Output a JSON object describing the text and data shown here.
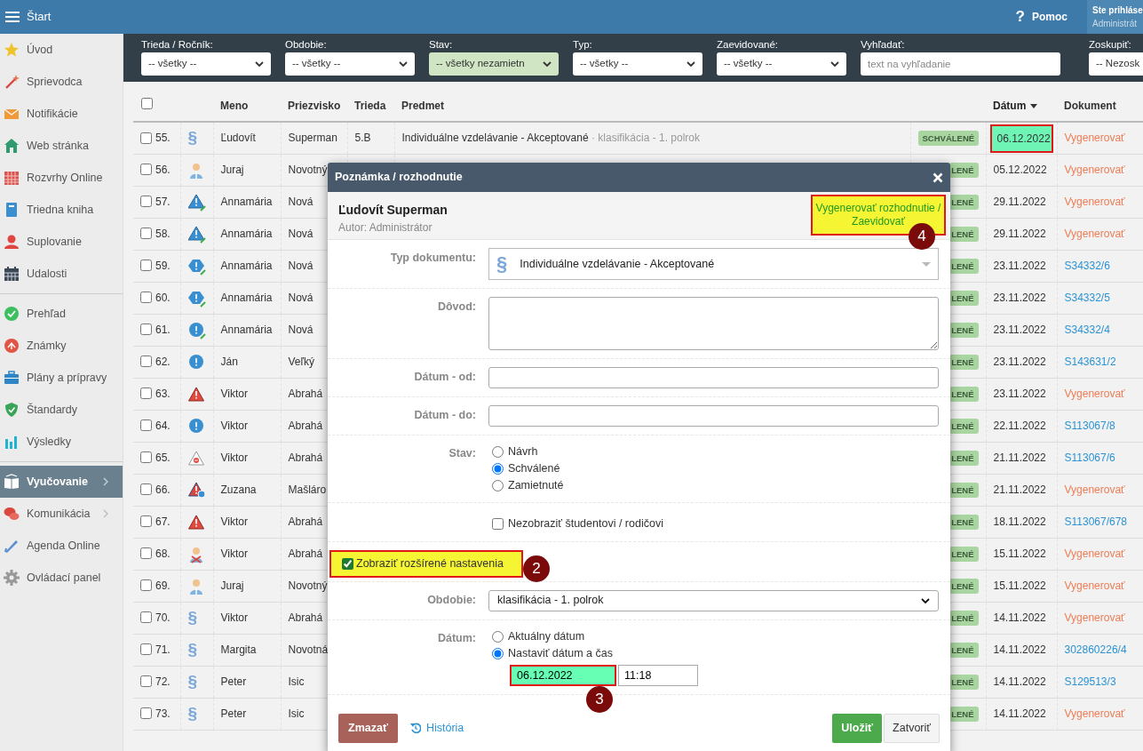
{
  "header": {
    "title": "Štart",
    "help_icon": "?",
    "help_label": "Pomoc",
    "user_line1": "Ste prihláse",
    "user_line2": "Administrát"
  },
  "sidebar": {
    "groups": [
      [
        {
          "label": "Úvod",
          "selected": false,
          "has_submenu": false
        },
        {
          "label": "Sprievodca",
          "selected": false,
          "has_submenu": false
        },
        {
          "label": "Notifikácie",
          "selected": false,
          "has_submenu": false
        },
        {
          "label": "Web stránka",
          "selected": false,
          "has_submenu": false
        },
        {
          "label": "Rozvrhy Online",
          "selected": false,
          "has_submenu": false
        },
        {
          "label": "Triedna kniha",
          "selected": false,
          "has_submenu": false
        },
        {
          "label": "Suplovanie",
          "selected": false,
          "has_submenu": false
        },
        {
          "label": "Udalosti",
          "selected": false,
          "has_submenu": false
        }
      ],
      [
        {
          "label": "Prehľad",
          "selected": false,
          "has_submenu": false
        },
        {
          "label": "Známky",
          "selected": false,
          "has_submenu": false
        },
        {
          "label": "Plány a prípravy",
          "selected": false,
          "has_submenu": false
        },
        {
          "label": "Štandardy",
          "selected": false,
          "has_submenu": false
        },
        {
          "label": "Výsledky",
          "selected": false,
          "has_submenu": false
        }
      ],
      [
        {
          "label": "Vyučovanie",
          "selected": true,
          "has_submenu": true
        },
        {
          "label": "Komunikácia",
          "selected": false,
          "has_submenu": true
        },
        {
          "label": "Agenda Online",
          "selected": false,
          "has_submenu": false
        },
        {
          "label": "Ovládací panel",
          "selected": false,
          "has_submenu": false
        }
      ]
    ]
  },
  "filters": [
    {
      "label": "Trieda / Ročník:",
      "kind": "select",
      "value": "-- všetky --",
      "highlighted": false
    },
    {
      "label": "Obdobie:",
      "kind": "select",
      "value": "-- všetky --",
      "highlighted": false
    },
    {
      "label": "Stav:",
      "kind": "select",
      "value": "-- všetky nezamietn",
      "highlighted": true
    },
    {
      "label": "Typ:",
      "kind": "select",
      "value": "-- všetky --",
      "highlighted": false
    },
    {
      "label": "Zaevidované:",
      "kind": "select",
      "value": "-- všetky --",
      "highlighted": false
    },
    {
      "label": "Vyhľadať:",
      "kind": "search",
      "placeholder": "text na vyhľadanie"
    },
    {
      "label": "Zoskupiť:",
      "kind": "select",
      "value": "-- Nezosk",
      "highlighted": false
    }
  ],
  "table": {
    "all_checked": false,
    "columns": [
      {
        "label": "Meno",
        "sorted": false
      },
      {
        "label": "Priezvisko",
        "sorted": false
      },
      {
        "label": "Trieda",
        "sorted": false
      },
      {
        "label": "Predmet",
        "sorted": false
      },
      {
        "label": "Dátum",
        "sorted": true
      },
      {
        "label": "Dokument",
        "sorted": false
      }
    ],
    "rows": [
      {
        "checked": false,
        "number": "55.",
        "kind": "paragraph",
        "symbol": "§",
        "name": "Ľudovít",
        "surname": "Superman",
        "class": "5.B",
        "subject": "Individuálne vzdelávanie - Akceptované",
        "subject_note": "· klasifikácia - 1. polrok",
        "status": "SCHVÁLENÉ",
        "date": "06.12.2022",
        "date_highlighted": true,
        "document": {
          "text": "Vygenerovať",
          "kind": "action"
        }
      },
      {
        "checked": false,
        "number": "56.",
        "kind": "person",
        "name": "Juraj",
        "surname": "Novotný",
        "status": "LENÉ",
        "date": "05.12.2022",
        "date_highlighted": false,
        "document": {
          "text": "Vygenerovať",
          "kind": "action"
        }
      },
      {
        "checked": false,
        "number": "57.",
        "kind": "draft",
        "name": "Annamária",
        "surname": "Nová",
        "status": "LENÉ",
        "date": "29.11.2022",
        "date_highlighted": false,
        "document": {
          "text": "Vygenerovať",
          "kind": "action"
        }
      },
      {
        "checked": false,
        "number": "58.",
        "kind": "draft",
        "name": "Annamária",
        "surname": "Nová",
        "status": "LENÉ",
        "date": "29.11.2022",
        "date_highlighted": false,
        "document": {
          "text": "Vygenerovať",
          "kind": "action"
        }
      },
      {
        "checked": false,
        "number": "59.",
        "kind": "pending",
        "name": "Annamária",
        "surname": "Nová",
        "status": "LENÉ",
        "date": "23.11.2022",
        "date_highlighted": false,
        "document": {
          "text": "S34332/6",
          "kind": "reference"
        }
      },
      {
        "checked": false,
        "number": "60.",
        "kind": "pending",
        "name": "Annamária",
        "surname": "Nová",
        "status": "LENÉ",
        "date": "23.11.2022",
        "date_highlighted": false,
        "document": {
          "text": "S34332/5",
          "kind": "reference"
        }
      },
      {
        "checked": false,
        "number": "61.",
        "kind": "noteedit",
        "name": "Annamária",
        "surname": "Nová",
        "status": "LENÉ",
        "date": "23.11.2022",
        "date_highlighted": false,
        "document": {
          "text": "S34332/4",
          "kind": "reference"
        }
      },
      {
        "checked": false,
        "number": "62.",
        "kind": "note",
        "name": "Ján",
        "surname": "Veľký",
        "status": "LENÉ",
        "date": "23.11.2022",
        "date_highlighted": false,
        "document": {
          "text": "S143631/2",
          "kind": "reference"
        }
      },
      {
        "checked": false,
        "number": "63.",
        "kind": "warning",
        "name": "Viktor",
        "surname": "Abrahá",
        "status": "LENÉ",
        "date": "23.11.2022",
        "date_highlighted": false,
        "document": {
          "text": "Vygenerovať",
          "kind": "action"
        }
      },
      {
        "checked": false,
        "number": "64.",
        "kind": "note",
        "name": "Viktor",
        "surname": "Abrahá",
        "status": "LENÉ",
        "date": "22.11.2022",
        "date_highlighted": false,
        "document": {
          "text": "S113067/8",
          "kind": "reference"
        }
      },
      {
        "checked": false,
        "number": "65.",
        "kind": "notice",
        "name": "Viktor",
        "surname": "Abrahá",
        "status": "LENÉ",
        "date": "21.11.2022",
        "date_highlighted": false,
        "document": {
          "text": "S113067/6",
          "kind": "reference"
        }
      },
      {
        "checked": false,
        "number": "66.",
        "kind": "escalated",
        "name": "Zuzana",
        "surname": "Mašláro",
        "status": "LENÉ",
        "date": "21.11.2022",
        "date_highlighted": false,
        "document": {
          "text": "Vygenerovať",
          "kind": "action"
        }
      },
      {
        "checked": false,
        "number": "67.",
        "kind": "warning",
        "name": "Viktor",
        "surname": "Abrahá",
        "status": "LENÉ",
        "date": "18.11.2022",
        "date_highlighted": false,
        "document": {
          "text": "S113067/678",
          "kind": "reference"
        }
      },
      {
        "checked": false,
        "number": "68.",
        "kind": "rejected",
        "name": "Viktor",
        "surname": "Abrahá",
        "status": "LENÉ",
        "date": "15.11.2022",
        "date_highlighted": false,
        "document": {
          "text": "Vygenerovať",
          "kind": "action"
        }
      },
      {
        "checked": false,
        "number": "69.",
        "kind": "person",
        "name": "Juraj",
        "surname": "Novotný",
        "status": "LENÉ",
        "date": "15.11.2022",
        "date_highlighted": false,
        "document": {
          "text": "Vygenerovať",
          "kind": "action"
        }
      },
      {
        "checked": false,
        "number": "70.",
        "kind": "paragraph",
        "symbol": "§",
        "name": "Viktor",
        "surname": "Abrahá",
        "status": "LENÉ",
        "date": "14.11.2022",
        "date_highlighted": false,
        "document": {
          "text": "Vygenerovať",
          "kind": "action"
        }
      },
      {
        "checked": false,
        "number": "71.",
        "kind": "paragraph",
        "symbol": "§",
        "name": "Margita",
        "surname": "Novotná",
        "status": "LENÉ",
        "date": "14.11.2022",
        "date_highlighted": false,
        "document": {
          "text": "302860226/4",
          "kind": "reference"
        }
      },
      {
        "checked": false,
        "number": "72.",
        "kind": "paragraph",
        "symbol": "§",
        "name": "Peter",
        "surname": "Isic",
        "status": "LENÉ",
        "date": "14.11.2022",
        "date_highlighted": false,
        "document": {
          "text": "S129513/3",
          "kind": "reference"
        }
      },
      {
        "checked": false,
        "number": "73.",
        "kind": "paragraph",
        "symbol": "§",
        "name": "Peter",
        "surname": "Isic",
        "status": "LENÉ",
        "date": "14.11.2022",
        "date_highlighted": false,
        "document": {
          "text": "Vygenerovať",
          "kind": "action"
        }
      }
    ]
  },
  "modal": {
    "title": "Poznámka / rozhodnutie",
    "person": "Ľudovít Superman",
    "author": "Autor: Administrátor",
    "action": "Vygenerovať rozhodnutie / Zaevidovať",
    "action_callout": "4",
    "fields": [
      {
        "kind": "select-icon",
        "label": "Typ dokumentu:",
        "symbol": "§",
        "value": "Individuálne vzdelávanie - Akceptované"
      },
      {
        "kind": "textarea",
        "label": "Dôvod:"
      },
      {
        "kind": "input",
        "label": "Dátum - od:"
      },
      {
        "kind": "input",
        "label": "Dátum - do:"
      },
      {
        "kind": "radios",
        "label": "Stav:",
        "options": [
          {
            "label": "Návrh",
            "selected": false
          },
          {
            "label": "Schválené",
            "selected": true
          },
          {
            "label": "Zamietnuté",
            "selected": false
          }
        ]
      },
      {
        "kind": "checkbox",
        "text": "Nezobraziť študentovi / rodičovi",
        "checked": false,
        "highlighted": false
      },
      {
        "kind": "checkbox",
        "text": "Zobraziť rozšírené nastavenia",
        "checked": true,
        "highlighted": true,
        "callout": "2"
      },
      {
        "kind": "select",
        "label": "Obdobie:",
        "value": "klasifikácia - 1. polrok"
      },
      {
        "kind": "date-radios",
        "label": "Dátum:",
        "options": [
          {
            "label": "Aktuálny dátum",
            "selected": false
          },
          {
            "label": "Nastaviť dátum a čas",
            "selected": true
          }
        ],
        "date": "06.12.2022",
        "date_highlighted": true,
        "date_callout": "3",
        "time": "11:18"
      }
    ],
    "buttons": [
      {
        "kind": "danger",
        "label": "Zmazať"
      },
      {
        "kind": "history",
        "label": "História"
      },
      {
        "kind": "save",
        "label": "Uložiť"
      },
      {
        "kind": "close",
        "label": "Zatvoriť"
      }
    ]
  }
}
